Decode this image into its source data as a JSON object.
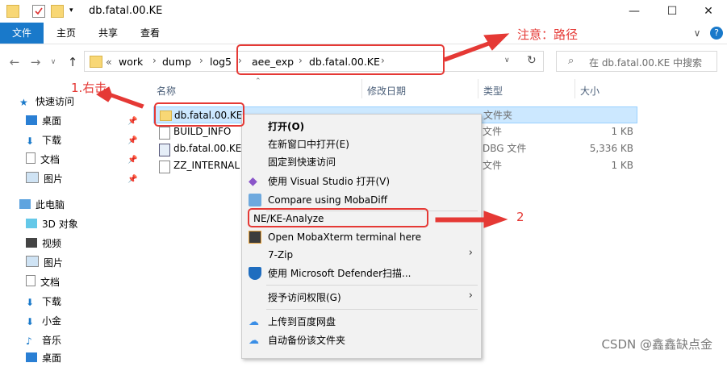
{
  "window": {
    "title": "db.fatal.00.KE",
    "minimize_icon": "minimize-icon",
    "maximize_icon": "maximize-icon",
    "close_icon": "close-icon"
  },
  "ribbon": {
    "tabs": [
      "文件",
      "主页",
      "共享",
      "查看"
    ],
    "chevron": "∨",
    "help": "?"
  },
  "address": {
    "crumbs": [
      "work",
      "dump",
      "log5",
      "aee_exp",
      "db.fatal.00.KE"
    ],
    "overflow": "«",
    "search_placeholder": "在 db.fatal.00.KE 中搜索"
  },
  "nav_pane": {
    "quick_access": "快速访问",
    "quick_items": [
      "桌面",
      "下载",
      "文档",
      "图片"
    ],
    "this_pc": "此电脑",
    "pc_items": [
      "3D 对象",
      "视频",
      "图片",
      "文档",
      "下载",
      "小金",
      "音乐",
      "桌面"
    ]
  },
  "columns": {
    "name": "名称",
    "modified": "修改日期",
    "type": "类型",
    "size": "大小"
  },
  "files": [
    {
      "name": "db.fatal.00.KE",
      "type": "文件夹",
      "size": ""
    },
    {
      "name": "BUILD_INFO",
      "type": "文件",
      "size": "1 KB"
    },
    {
      "name": "db.fatal.00.KE",
      "type": "DBG 文件",
      "size": "5,336 KB"
    },
    {
      "name": "ZZ_INTERNAL",
      "type": "文件",
      "size": "1 KB"
    }
  ],
  "context_menu": {
    "items": [
      "打开(O)",
      "在新窗口中打开(E)",
      "固定到快速访问",
      "使用 Visual Studio 打开(V)",
      "Compare using MobaDiff",
      "NE/KE-Analyze",
      "Open MobaXterm terminal here",
      "7-Zip",
      "使用 Microsoft Defender扫描...",
      "授予访问权限(G)",
      "上传到百度网盘",
      "自动备份该文件夹"
    ]
  },
  "annotations": {
    "note_path": "注意：路径",
    "step1": "1.右击",
    "step2": "2"
  },
  "watermark": "CSDN @鑫鑫缺点金",
  "colors": {
    "accent": "#1979ca",
    "annotation": "#e53935",
    "selection": "#cce8ff",
    "folder": "#f8d775"
  }
}
